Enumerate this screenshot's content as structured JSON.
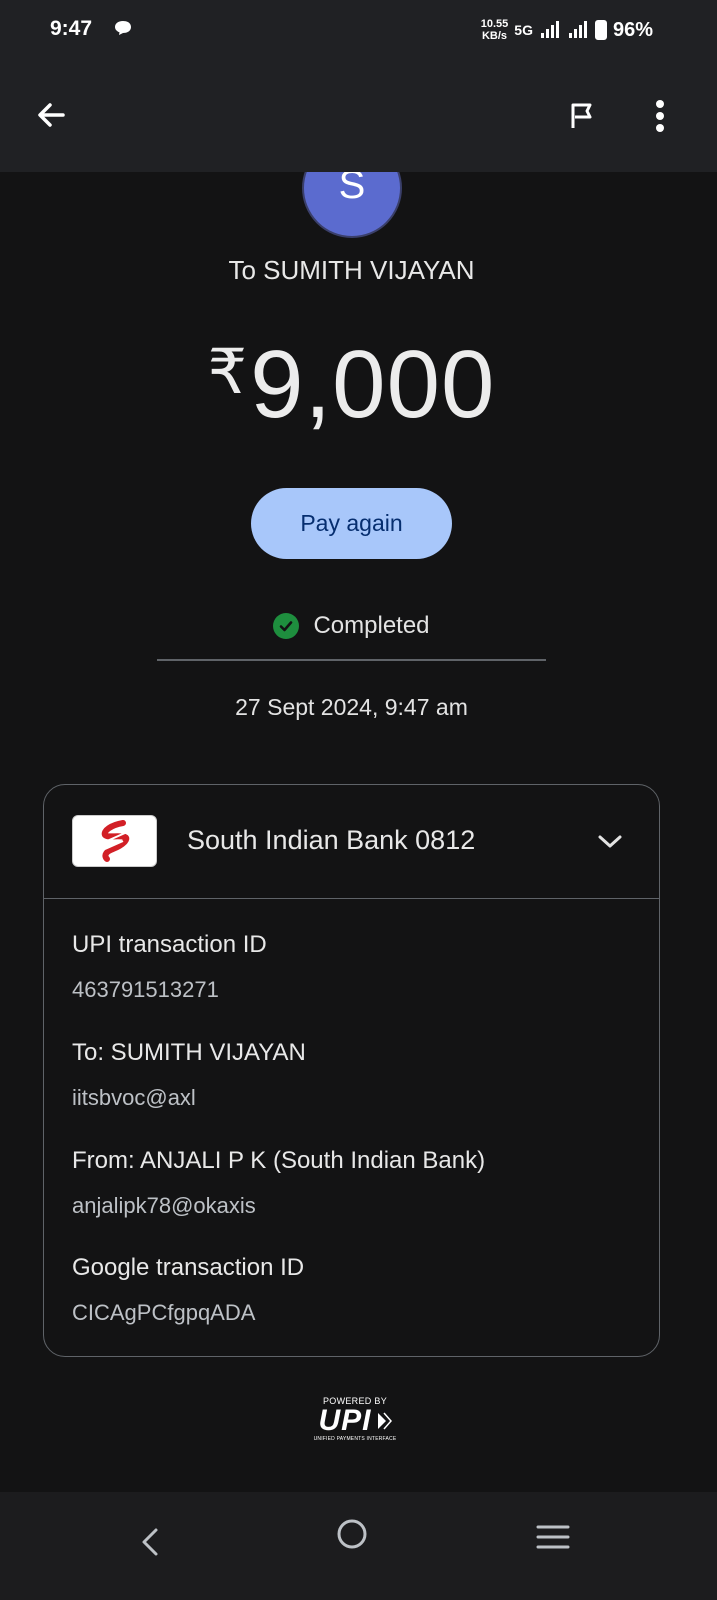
{
  "status_bar": {
    "time": "9:47",
    "net_speed_value": "10.55",
    "net_speed_unit": "KB/s",
    "network": "5G",
    "battery": "96%"
  },
  "transaction": {
    "avatar_letter": "S",
    "recipient_line": "To SUMITH VIJAYAN",
    "currency_symbol": "₹",
    "amount": "9,000",
    "pay_again_label": "Pay again",
    "status": "Completed",
    "datetime": "27 Sept 2024, 9:47 am"
  },
  "details_card": {
    "bank_name": "South Indian Bank 0812",
    "items": [
      {
        "label": "UPI transaction ID",
        "value": "463791513271"
      },
      {
        "label": "To: SUMITH VIJAYAN",
        "value": "iitsbvoc@axl"
      },
      {
        "label": "From: ANJALI P K (South Indian Bank)",
        "value": "anjalipk78@okaxis"
      },
      {
        "label": "Google transaction ID",
        "value": "CICAgPCfgpqADA"
      }
    ]
  },
  "footer": {
    "powered_by": "POWERED BY",
    "upi": "UPI",
    "upi_full": "UNIFIED PAYMENTS INTERFACE"
  },
  "colors": {
    "background": "#131314",
    "header": "#202124",
    "pay_again_bg": "#a8c7fa",
    "pay_again_text": "#062e6f",
    "success_green": "#1e8e3e",
    "avatar_bg": "#5b6bcf"
  },
  "icons": {
    "back": "arrow-left-icon",
    "report": "flag-icon",
    "more": "more-vert-icon",
    "status": "check-circle-icon",
    "expand": "chevron-down-icon"
  }
}
